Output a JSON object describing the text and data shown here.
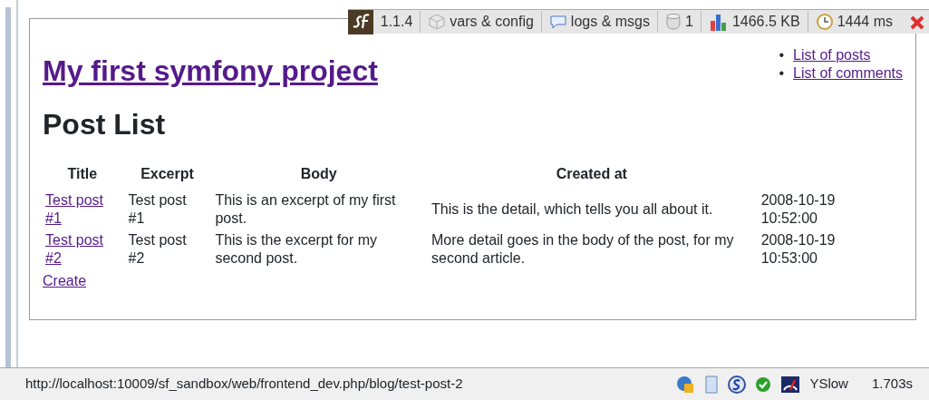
{
  "debug_toolbar": {
    "version": "1.1.4",
    "items": [
      {
        "kind": "config",
        "label": "vars & config"
      },
      {
        "kind": "logs",
        "label": "logs & msgs"
      },
      {
        "kind": "db",
        "label": "1"
      },
      {
        "kind": "memory",
        "label": "1466.5 KB"
      },
      {
        "kind": "time",
        "label": "1444 ms"
      }
    ]
  },
  "site_title": "My first symfony project",
  "nav_links": [
    {
      "bullet": "•",
      "label": "List of posts"
    },
    {
      "bullet": "•",
      "label": "List of comments"
    }
  ],
  "heading": "Post List",
  "table": {
    "columns": [
      "Title",
      "Excerpt",
      "Body",
      "Created at"
    ],
    "rows": [
      {
        "title": "Test post #1",
        "excerpt": "Test post #1",
        "body": "This is an excerpt of my first post.",
        "detail": "This is the detail, which tells you all about it.",
        "created_at": "2008-10-19 10:52:00"
      },
      {
        "title": "Test post #2",
        "excerpt": "Test post #2",
        "body": "This is the excerpt for my second post.",
        "detail": "More detail goes in the body of the post, for my second article.",
        "created_at": "2008-10-19 10:53:00"
      }
    ]
  },
  "create_link": "Create",
  "status_bar": {
    "url": "http://localhost:10009/sf_sandbox/web/frontend_dev.php/blog/test-post-2",
    "yslow": "YSlow",
    "time": "1.703s"
  }
}
